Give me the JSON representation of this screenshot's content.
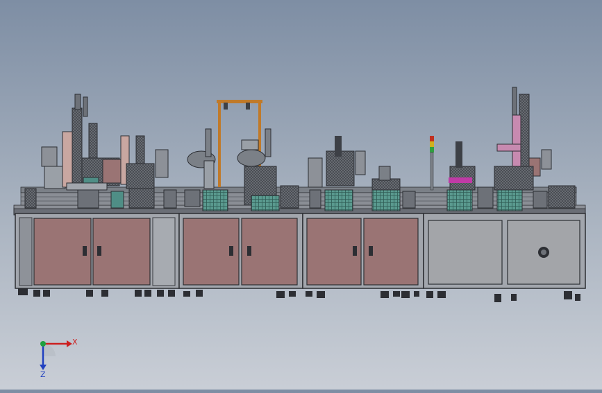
{
  "scene": {
    "background_top": "#7e8ea4",
    "background_bottom": "#c9ced6",
    "frame_color": "#5a5e66",
    "frame_light": "#a2a6ad",
    "panel_color": "#9a7474",
    "panel_gray": "#a3a5a9",
    "fixture_teal": "#4f8e86",
    "accent_pink": "#c78ab0",
    "accent_magenta": "#c03aa6",
    "cable_orange": "#c07a2a"
  },
  "triad": {
    "x_label": "X",
    "z_label": "Z",
    "x_color": "#cc2020",
    "y_color": "#20a040",
    "z_color": "#2040c0"
  }
}
